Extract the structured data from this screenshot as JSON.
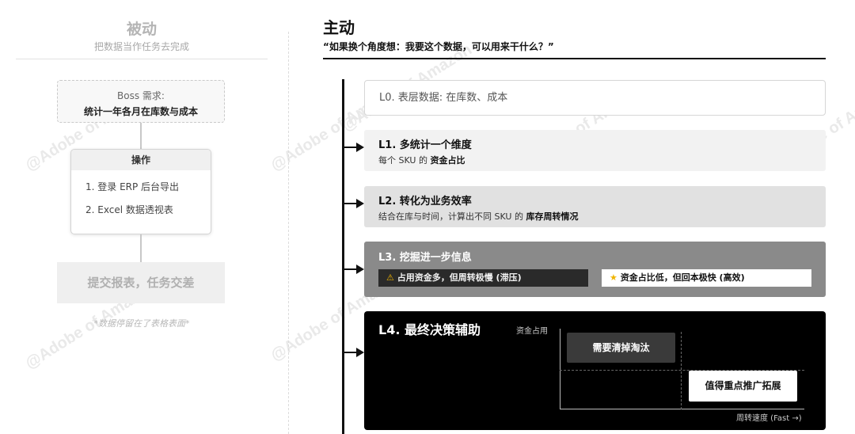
{
  "watermark": "@Adobe of Amazon",
  "passive": {
    "title": "被动",
    "subtitle": "把数据当作任务去完成",
    "boss_box": {
      "line1": "Boss 需求:",
      "line2": "统计一年各月在库数与成本"
    },
    "operation": {
      "header": "操作",
      "items": [
        "1. 登录 ERP 后台导出",
        "2. Excel 数据透视表"
      ]
    },
    "submit": "提交报表，任务交差",
    "note": "*数据停留在了表格表面*"
  },
  "active": {
    "title": "主动",
    "quote": "“如果换个角度想：我要这个数据，可以用来干什么？”",
    "levels": {
      "l0": {
        "text": "L0. 表层数据: 在库数、成本"
      },
      "l1": {
        "title": "L1. 多统计一个维度",
        "desc_prefix": "每个 SKU 的 ",
        "desc_bold": "资金占比"
      },
      "l2": {
        "title": "L2. 转化为业务效率",
        "desc_prefix": "结合在库与时间，计算出不同 SKU 的 ",
        "desc_bold": "库存周转情况"
      },
      "l3": {
        "title": "L3. 挖掘进一步信息",
        "tag_warning": "占用资金多，但周转极慢 (滞压)",
        "tag_star": "资金占比低，但回本极快 (高效)",
        "warning_icon": "⚠",
        "star_icon": "★"
      },
      "l4": {
        "title": "L4. 最终决策辅助",
        "y_axis_label": "资金占用",
        "x_axis_label": "周转速度 (Fast →)",
        "quadrant_top_left": "需要清掉淘汰",
        "quadrant_bottom_right": "值得重点推广拓展"
      }
    }
  }
}
